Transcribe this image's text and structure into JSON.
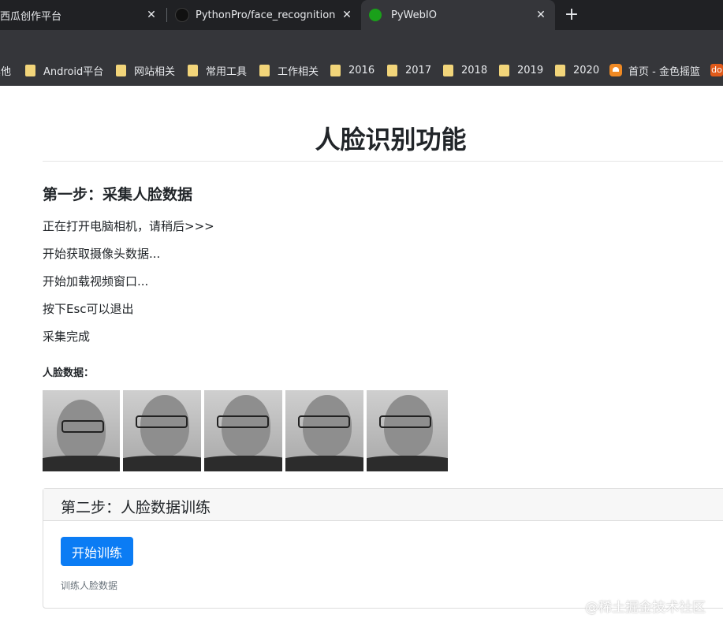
{
  "browser": {
    "tabs": [
      {
        "title": "西瓜创作平台",
        "active": false
      },
      {
        "title": "PythonPro/face_recognition at",
        "active": false
      },
      {
        "title": "PyWebIO",
        "active": true
      }
    ],
    "bookmarks": [
      {
        "label": "其他"
      },
      {
        "label": "Android平台"
      },
      {
        "label": "网站相关"
      },
      {
        "label": "常用工具"
      },
      {
        "label": "工作相关"
      },
      {
        "label": "2016"
      },
      {
        "label": "2017"
      },
      {
        "label": "2018"
      },
      {
        "label": "2019"
      },
      {
        "label": "2020"
      },
      {
        "label": "首页 - 金色摇篮"
      },
      {
        "label": "do"
      }
    ]
  },
  "page": {
    "title": "人脸识别功能",
    "step1": {
      "heading": "第一步：采集人脸数据",
      "messages": [
        "正在打开电脑相机，请稍后>>>",
        "开始获取摄像头数据...",
        "开始加载视频窗口...",
        "按下Esc可以退出",
        "采集完成"
      ],
      "faces_label": "人脸数据："
    },
    "step2": {
      "heading": "第二步：人脸数据训练",
      "button_label": "开始训练",
      "help_text": "训练人脸数据"
    },
    "watermark": "@稀土掘金技术社区"
  }
}
